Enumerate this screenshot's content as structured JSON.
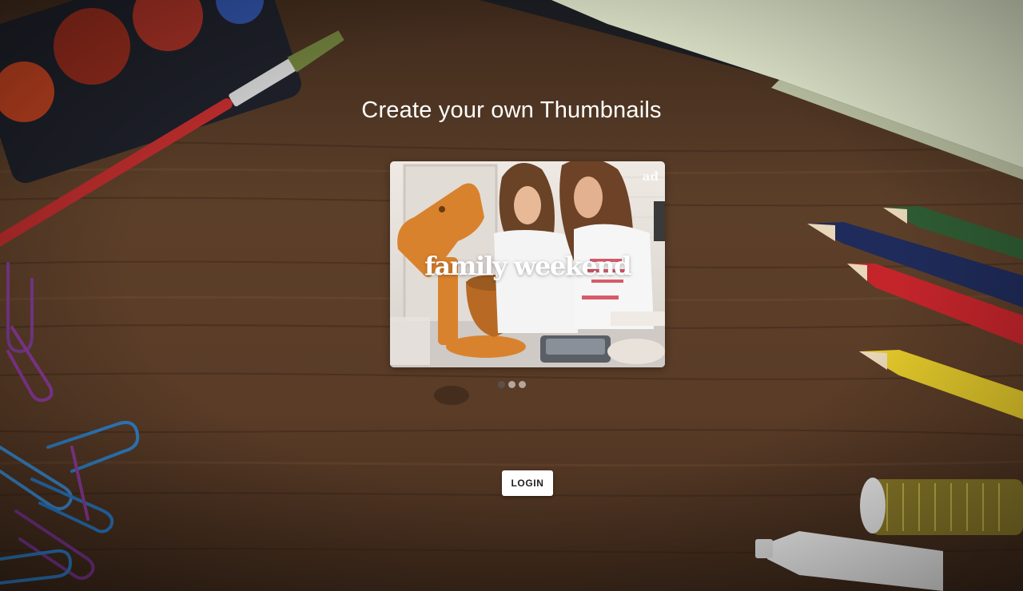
{
  "page": {
    "headline": "Create your own Thumbnails"
  },
  "carousel": {
    "active_index": 0,
    "slide_count": 3,
    "current_slide": {
      "caption": "family weekend",
      "badge": "ad"
    }
  },
  "actions": {
    "login_label": "LOGIN"
  },
  "colors": {
    "headline_text": "#ffffff",
    "button_bg": "#ffffff",
    "button_text": "#222222",
    "active_dot": "#5a5a5a",
    "inactive_dot": "#d9d9d9",
    "desk_wood": "#5a3d28"
  }
}
